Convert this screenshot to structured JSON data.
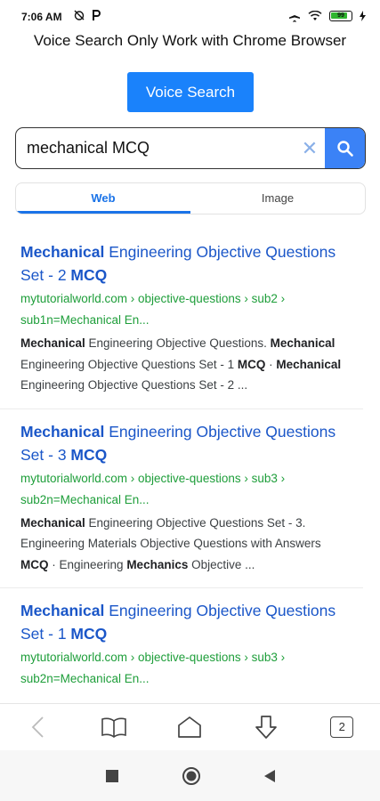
{
  "status": {
    "time": "7:06 AM",
    "battery": "99"
  },
  "notice": "Voice Search Only Work with Chrome Browser",
  "voice_button": "Voice Search",
  "search": {
    "value": "mechanical MCQ"
  },
  "tabs": [
    {
      "label": "Web",
      "active": true
    },
    {
      "label": "Image",
      "active": false
    }
  ],
  "results": [
    {
      "title_parts": [
        [
          "Mechanical",
          true
        ],
        [
          " Engineering Objective Questions Set - 2 ",
          false
        ],
        [
          "MCQ",
          true
        ]
      ],
      "url": "mytutorialworld.com › objective-questions › sub2 › sub1n=Mechanical En...",
      "snippet_parts": [
        [
          "Mechanical",
          true
        ],
        [
          " Engineering Objective Questions. ",
          false
        ],
        [
          "Mechanical",
          true
        ],
        [
          " Engineering Objective Questions Set - 1 ",
          false
        ],
        [
          "MCQ",
          true
        ],
        [
          " · ",
          false
        ],
        [
          "Mechanical",
          true
        ],
        [
          " Engineering Objective Questions Set - 2 ...",
          false
        ]
      ]
    },
    {
      "title_parts": [
        [
          "Mechanical",
          true
        ],
        [
          " Engineering Objective Questions Set - 3 ",
          false
        ],
        [
          "MCQ",
          true
        ]
      ],
      "url": "mytutorialworld.com › objective-questions › sub3 › sub2n=Mechanical En...",
      "snippet_parts": [
        [
          "Mechanical",
          true
        ],
        [
          " Engineering Objective Questions Set - 3. Engineering Materials Objective Questions with Answers ",
          false
        ],
        [
          "MCQ",
          true
        ],
        [
          " · Engineering ",
          false
        ],
        [
          "Mechanics",
          true
        ],
        [
          " Objective ...",
          false
        ]
      ]
    },
    {
      "title_parts": [
        [
          "Mechanical",
          true
        ],
        [
          " Engineering Objective Questions Set - 1 ",
          false
        ],
        [
          "MCQ",
          true
        ]
      ],
      "url": "mytutorialworld.com › objective-questions › sub3 › sub2n=Mechanical En...",
      "snippet_parts": []
    }
  ],
  "bottom_nav": {
    "icons": [
      "back-icon",
      "bookmarks-icon",
      "home-icon",
      "download-icon",
      "tabs-icon"
    ],
    "tab_count": "2"
  },
  "system_nav": {
    "icons": [
      "recents-icon",
      "home-circle-icon",
      "back-triangle-icon"
    ]
  },
  "colors": {
    "accent": "#1a82fb",
    "link": "#1a56c8",
    "url": "#1e9e3a"
  }
}
